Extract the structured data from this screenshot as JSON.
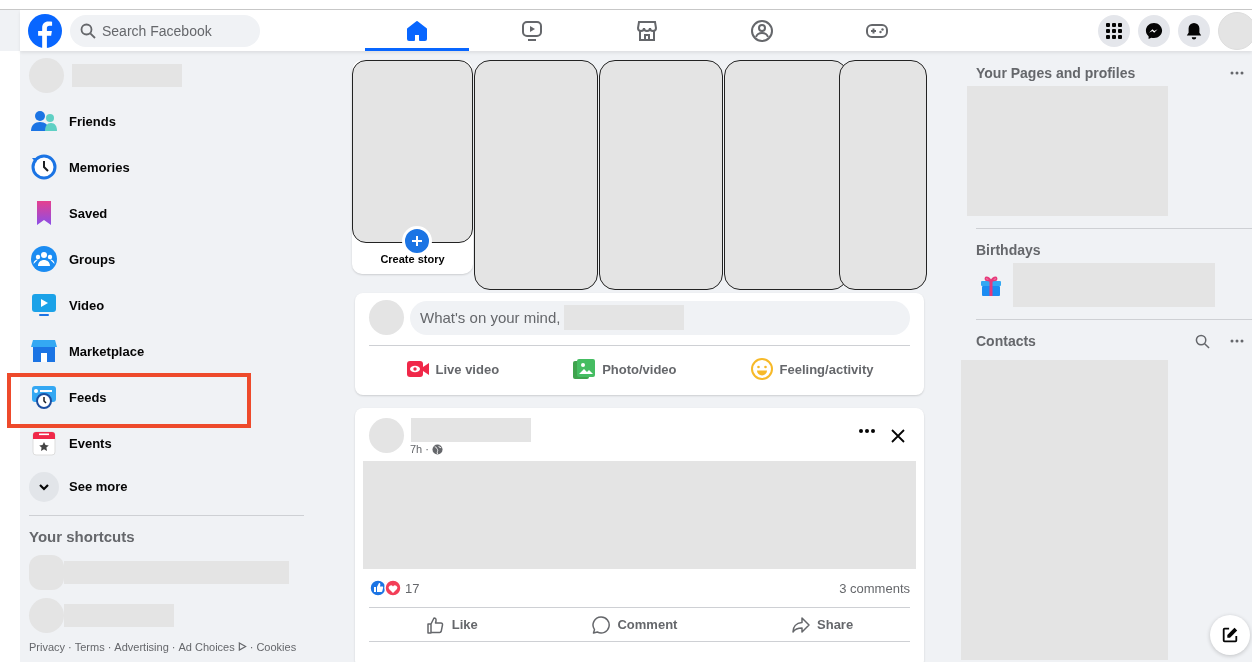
{
  "header": {
    "search": {
      "placeholder": "Search Facebook"
    },
    "nav_tabs": [
      {
        "kind": "home",
        "selected": true
      },
      {
        "kind": "video",
        "selected": false
      },
      {
        "kind": "marketplace",
        "selected": false
      },
      {
        "kind": "groups",
        "selected": false
      },
      {
        "kind": "gaming",
        "selected": false
      }
    ]
  },
  "sidebar": {
    "items": [
      {
        "kind": "friends",
        "label": "Friends",
        "highlighted": false
      },
      {
        "kind": "memories",
        "label": "Memories",
        "highlighted": false
      },
      {
        "kind": "saved",
        "label": "Saved",
        "highlighted": false
      },
      {
        "kind": "groups",
        "label": "Groups",
        "highlighted": false
      },
      {
        "kind": "video",
        "label": "Video",
        "highlighted": false
      },
      {
        "kind": "marketplace",
        "label": "Marketplace",
        "highlighted": false
      },
      {
        "kind": "feeds",
        "label": "Feeds",
        "highlighted": true
      },
      {
        "kind": "events",
        "label": "Events",
        "highlighted": false
      }
    ],
    "see_more": "See more",
    "shortcuts_title": "Your shortcuts",
    "footer_links": [
      "Privacy",
      "Terms",
      "Advertising",
      "Ad Choices",
      "Cookies"
    ],
    "footer_separator": "·"
  },
  "stories": [
    {
      "kind": "create",
      "label": "Create story"
    },
    {
      "kind": "hidden"
    },
    {
      "kind": "hidden"
    },
    {
      "kind": "hidden"
    },
    {
      "kind": "hidden"
    }
  ],
  "composer": {
    "placeholder": "What's on your mind,",
    "actions": [
      {
        "kind": "live",
        "label": "Live video"
      },
      {
        "kind": "photo",
        "label": "Photo/video"
      },
      {
        "kind": "feeling",
        "label": "Feeling/activity"
      }
    ]
  },
  "post": {
    "time": "7h ·",
    "reactions_count": "17",
    "comments": "3 comments",
    "actions": [
      {
        "kind": "like",
        "label": "Like"
      },
      {
        "kind": "comment",
        "label": "Comment"
      },
      {
        "kind": "share",
        "label": "Share"
      }
    ]
  },
  "right": {
    "pages_title": "Your Pages and profiles",
    "birthdays_title": "Birthdays",
    "contacts_title": "Contacts"
  }
}
